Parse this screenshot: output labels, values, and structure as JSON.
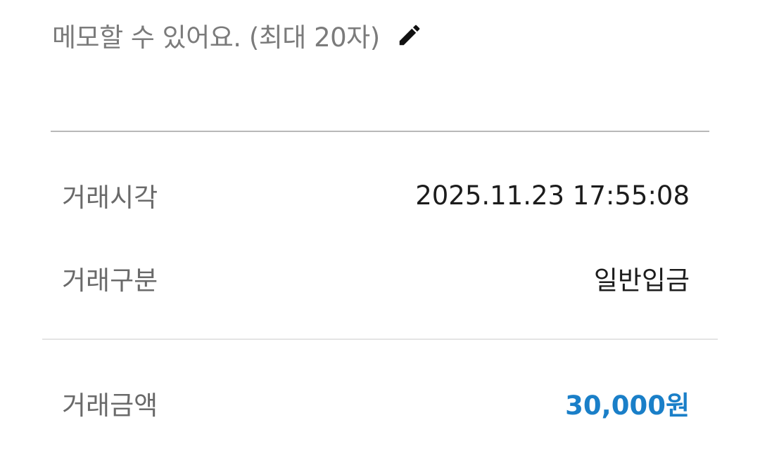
{
  "memo": {
    "placeholder": "메모할 수 있어요. (최대 20자)",
    "edit_icon": "pencil-icon"
  },
  "details": {
    "time_label": "거래시각",
    "time_value": "2025.11.23 17:55:08",
    "type_label": "거래구분",
    "type_value": "일반입금",
    "amount_label": "거래금액",
    "amount_value": "30,000원"
  },
  "colors": {
    "amount": "#1a7fc8",
    "label": "#6a6a6a",
    "value": "#1c1c1c",
    "placeholder": "#7b7b7b"
  }
}
